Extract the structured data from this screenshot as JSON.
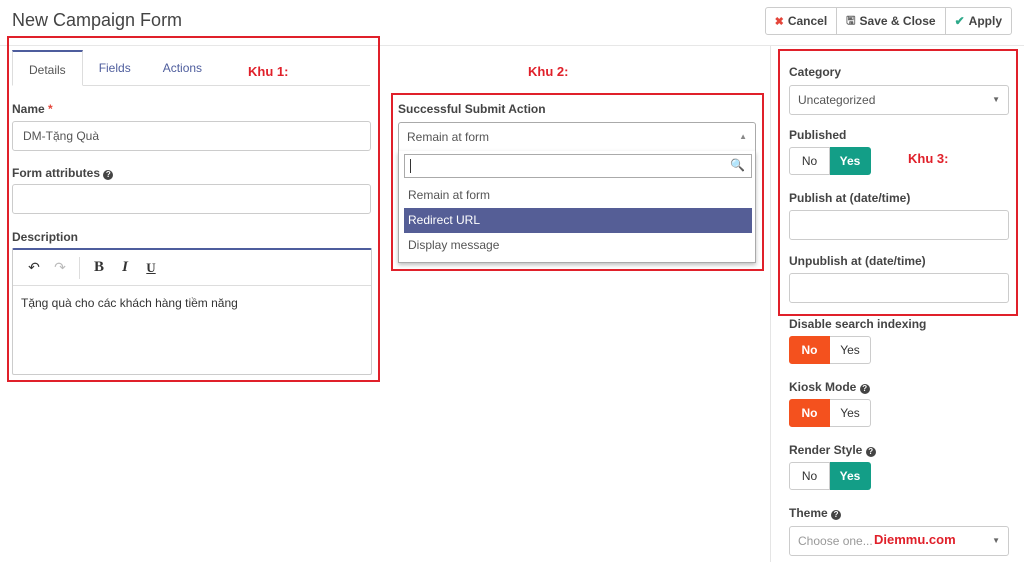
{
  "header": {
    "title": "New Campaign Form",
    "cancel_label": "Cancel",
    "save_close_label": "Save & Close",
    "apply_label": "Apply"
  },
  "tabs": [
    {
      "label": "Details",
      "active": true
    },
    {
      "label": "Fields",
      "active": false
    },
    {
      "label": "Actions",
      "active": false
    }
  ],
  "annotations": {
    "khu1": "Khu 1:",
    "khu2": "Khu 2:",
    "khu3": "Khu 3:",
    "watermark": "Diemmu.com",
    "color": "#e0202a"
  },
  "details": {
    "name_label": "Name",
    "name_required": "*",
    "name_value": "DM-Tặng Quà",
    "form_attributes_label": "Form attributes",
    "form_attributes_value": "",
    "description_label": "Description",
    "description_value": "Tặng quà cho các khách hàng tiềm năng",
    "editor_tools": [
      "undo-icon",
      "redo-icon",
      "bold-icon",
      "italic-icon",
      "underline-icon"
    ]
  },
  "actions": {
    "submit_action_label": "Successful Submit Action",
    "submit_action_value": "Remain at form",
    "search_value": "",
    "options": [
      "Remain at form",
      "Redirect URL",
      "Display message"
    ],
    "highlighted_option": "Redirect URL"
  },
  "sidebar": {
    "category_label": "Category",
    "category_value": "Uncategorized",
    "published_label": "Published",
    "published": "Yes",
    "publish_at_label": "Publish at (date/time)",
    "publish_at_value": "",
    "unpublish_at_label": "Unpublish at (date/time)",
    "unpublish_at_value": "",
    "disable_search_label": "Disable search indexing",
    "disable_search": "No",
    "kiosk_label": "Kiosk Mode",
    "kiosk": "No",
    "render_style_label": "Render Style",
    "render_style": "Yes",
    "theme_label": "Theme",
    "theme_placeholder": "Choose one...",
    "no_label": "No",
    "yes_label": "Yes"
  },
  "colors": {
    "accent": "#4e5d9d",
    "yes_active": "#139e87",
    "no_active": "#f4511e",
    "highlight": "#555e96"
  }
}
